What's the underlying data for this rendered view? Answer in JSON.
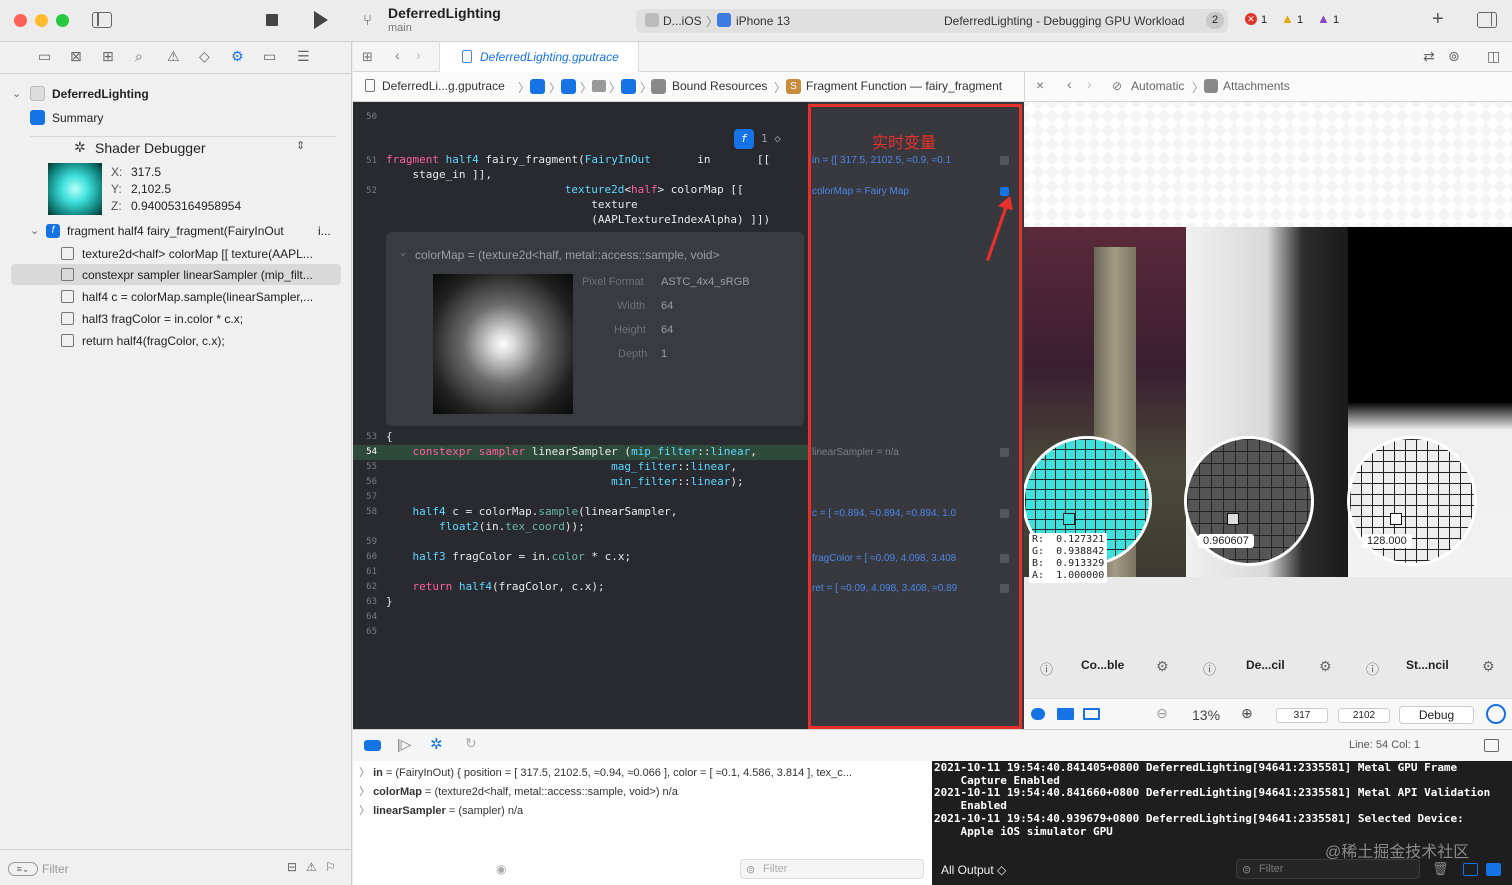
{
  "titlebar": {
    "project": "DeferredLighting",
    "branch": "main",
    "scheme_target": "D...iOS",
    "device": "iPhone 13",
    "status": "DeferredLighting - Debugging GPU Workload",
    "status_count": "2",
    "errors": "1",
    "warnings": "1",
    "issues": "1"
  },
  "tabbar": {
    "tab": "DeferredLighting.gputrace"
  },
  "breadcrumb": {
    "file": "DeferredLi...g.gputrace",
    "bound": "Bound Resources",
    "function": "Fragment Function — fairy_fragment",
    "mode": "Automatic",
    "attachments": "Attachments"
  },
  "sidebar": {
    "root": "DeferredLighting",
    "summary": "Summary",
    "debugger_title": "Shader Debugger",
    "coords": {
      "x_label": "X:",
      "x": "317.5",
      "y_label": "Y:",
      "y": "2,102.5",
      "z_label": "Z:",
      "z": "0.940053164958954"
    },
    "function_item": "fragment half4 fairy_fragment(FairyInOut",
    "function_suffix": "i...",
    "steps": [
      "texture2d<half> colorMap [[ texture(AAPL...",
      "constexpr sampler linearSampler (mip_filt...",
      "half4 c = colorMap.sample(linearSampler,...",
      "half3 fragColor = in.color * c.x;",
      "return half4(fragColor, c.x);"
    ],
    "filter_placeholder": "Filter"
  },
  "editor": {
    "line_numbers": [
      "50",
      "51",
      "52",
      "53",
      "54",
      "55",
      "56",
      "57",
      "58",
      "59",
      "60",
      "61",
      "62",
      "63",
      "64",
      "65"
    ],
    "lines": {
      "l51a": "fragment half4 fairy_fragment(FairyInOut       in       [[",
      "l51b": "    stage_in ]],",
      "l52a": "                           texture2d<half> colorMap [[",
      "l52b": "                               texture",
      "l52c": "                               (AAPLTextureIndexAlpha) ]])",
      "l53": "{",
      "l54": "    constexpr sampler linearSampler (mip_filter::linear,",
      "l55": "                                  mag_filter::linear,",
      "l56": "                                  min_filter::linear);",
      "l58a": "    half4 c = colorMap.sample(linearSampler,",
      "l58b": "        float2(in.tex_coord));",
      "l60": "    half3 fragColor = in.color * c.x;",
      "l62": "    return half4(fragColor, c.x);",
      "l63": "}"
    },
    "popover": {
      "title": "colorMap = (texture2d<half, metal::access::sample, void>",
      "pixel_format_label": "Pixel Format",
      "pixel_format": "ASTC_4x4_sRGB",
      "width_label": "Width",
      "width": "64",
      "height_label": "Height",
      "height": "64",
      "depth_label": "Depth",
      "depth": "1"
    },
    "badge": "1 ◇"
  },
  "varcol": {
    "annotation": "实时变量",
    "in": "in = {[ 317.5, 2102.5, ≈0.9, ≈0.1",
    "colormap": "colorMap = Fairy Map",
    "sampler": "linearSampler = n/a",
    "c": "c = [ ≈0.894, ≈0.894, ≈0.894, 1.0",
    "fragcolor": "fragColor = [ ≈0.09, 4.098, 3.408",
    "ret": "ret = [ ≈0.09, 4.098, 3.408, ≈0.89"
  },
  "attachments": {
    "color": {
      "title": "Co...ble",
      "r": "R:  0.127321",
      "g": "G:  0.938842",
      "b": "B:  0.913329",
      "a": "A:  1.000000"
    },
    "depth": {
      "title": "De...cil",
      "value": "0.960607"
    },
    "stencil": {
      "title": "St...ncil",
      "value": "128.000"
    },
    "zoom": "13%",
    "x": "317",
    "y": "2102",
    "mode": "Debug"
  },
  "debugbar": {
    "line_col": "Line: 54  Col: 1"
  },
  "variables": [
    {
      "name": "in",
      "value": " = (FairyInOut) { position = [ 317.5, 2102.5, ≈0.94, ≈0.066 ], color = [ ≈0.1, 4.586, 3.814 ], tex_c..."
    },
    {
      "name": "colorMap",
      "value": " = (texture2d<half, metal::access::sample, void>) n/a"
    },
    {
      "name": "linearSampler",
      "value": " = (sampler) n/a"
    }
  ],
  "variables_filter": "Filter",
  "console": {
    "lines": [
      "2021-10-11 19:54:40.841405+0800 DeferredLighting[94641:2335581] Metal GPU Frame",
      "    Capture Enabled",
      "2021-10-11 19:54:40.841660+0800 DeferredLighting[94641:2335581] Metal API Validation",
      "    Enabled",
      "2021-10-11 19:54:40.939679+0800 DeferredLighting[94641:2335581] Selected Device:",
      "    Apple iOS simulator GPU"
    ],
    "output": "All Output ◇",
    "filter": "Filter",
    "watermark": "@稀土掘金技术社区"
  },
  "colors": {
    "red": "#e8302a",
    "blue": "#1673e6",
    "editor_bg": "#292a30",
    "teal": "#3fe0dc"
  }
}
